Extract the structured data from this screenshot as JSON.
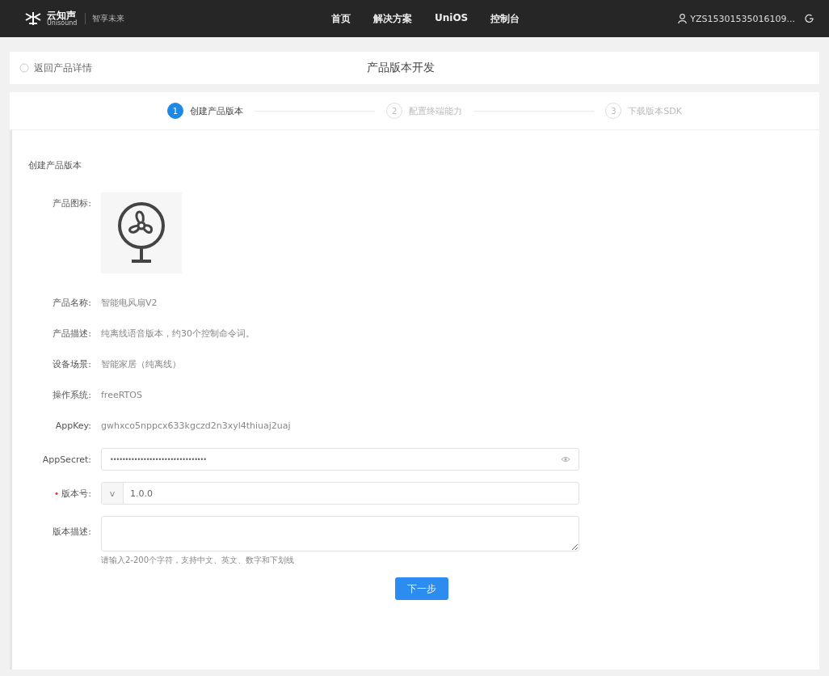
{
  "topbar": {
    "logo_name": "云知声",
    "logo_sub": "Unisound",
    "slogan": "智享未来",
    "nav": [
      {
        "label": "首页",
        "selected": false
      },
      {
        "label": "解决方案",
        "selected": false
      },
      {
        "label": "UniOS",
        "selected": false
      },
      {
        "label": "控制台",
        "selected": false
      }
    ],
    "user": "YZS15301535016109..."
  },
  "header": {
    "back": "返回产品详情",
    "title": "产品版本开发"
  },
  "steps": [
    {
      "number": "1",
      "label": "创建产品版本",
      "selected": true
    },
    {
      "number": "2",
      "label": "配置终端能力",
      "selected": false
    },
    {
      "number": "3",
      "label": "下载版本SDK",
      "selected": false
    }
  ],
  "section_title": "创建产品版本",
  "icon_label": "产品图标:",
  "details": [
    {
      "label": "产品名称:",
      "value": "智能电风扇V2"
    },
    {
      "label": "产品描述:",
      "value": "纯离线语音版本，约30个控制命令词。"
    },
    {
      "label": "设备场景:",
      "value": "智能家居（纯离线）"
    },
    {
      "label": "操作系统:",
      "value": "freeRTOS"
    },
    {
      "label": "AppKey:",
      "value": "gwhxco5nppcx633kgczd2n3xyl4thiuaj2uaj"
    }
  ],
  "secret": {
    "label": "AppSecret:",
    "value": "••••••••••••••••••••••••••••••••"
  },
  "version": {
    "label": "版本号:",
    "required_mark": "•",
    "prefix": "v",
    "value": "1.0.0"
  },
  "description": {
    "label": "版本描述:",
    "hint": "请输入2-200个字符，支持中文、英文、数字和下划线"
  },
  "next_button": "下一步"
}
